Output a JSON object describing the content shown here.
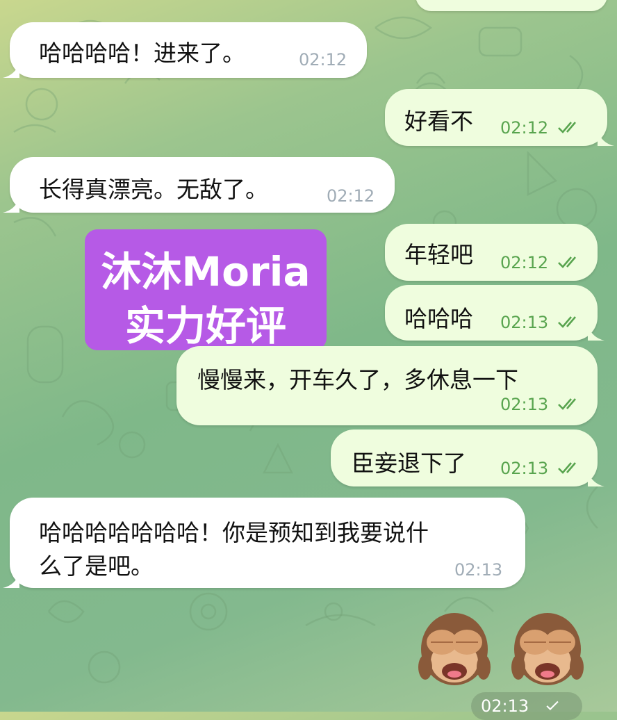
{
  "messages": [
    {
      "side": "out",
      "text": "",
      "time": ""
    },
    {
      "side": "in",
      "text": "哈哈哈哈！进来了。",
      "time": "02:12"
    },
    {
      "side": "out",
      "text": "好看不",
      "time": "02:12"
    },
    {
      "side": "in",
      "text": "长得真漂亮。无敌了。",
      "time": "02:12"
    },
    {
      "side": "out",
      "text": "年轻吧",
      "time": "02:12"
    },
    {
      "side": "out",
      "text": "哈哈哈",
      "time": "02:13"
    },
    {
      "side": "out",
      "text": "慢慢来，开车久了，多休息一下",
      "time": "02:13"
    },
    {
      "side": "out",
      "text": "臣妾退下了",
      "time": "02:13"
    },
    {
      "side": "in",
      "text_line1": "哈哈哈哈哈哈哈！你是预知到我要说什",
      "text_line2": "么了是吧。",
      "time": "02:13"
    }
  ],
  "sticker_message": {
    "emoji": [
      "see-no-evil-monkey",
      "see-no-evil-monkey"
    ],
    "time": "02:13"
  },
  "overlay": {
    "line1": "沐沐Moria",
    "line2": "实力好评",
    "color": "#b65ae6"
  },
  "colors": {
    "incoming_bubble": "#ffffff",
    "outgoing_bubble": "#effdde",
    "outgoing_time": "#58a44e",
    "incoming_time": "#a0acb6"
  }
}
